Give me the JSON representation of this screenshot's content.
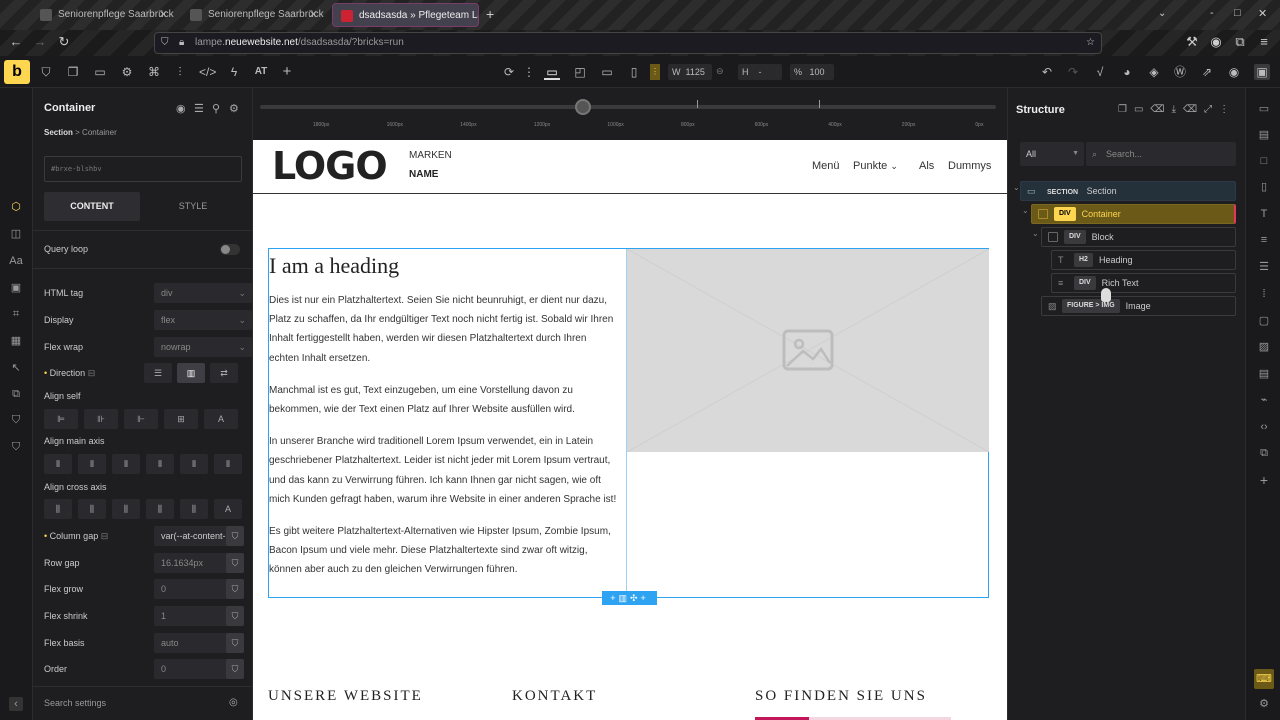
{
  "browser": {
    "tabs": [
      {
        "label": "Seniorenpflege Saarbrücken",
        "active": false
      },
      {
        "label": "Seniorenpflege Saarbrücken",
        "active": false
      },
      {
        "label": "dsadsasda » Pflegeteam La",
        "active": true
      }
    ],
    "new_tab": "+",
    "url_prefix": "lampe.",
    "url_domain": "neuewebsite.net",
    "url_path": "/dsadsasda/?bricks=run"
  },
  "toolbar": {
    "brand": "b",
    "at_label": "AT",
    "width_label": "W",
    "width_value": "1125",
    "height_label": "H",
    "height_value": "-",
    "zoom_label": "%",
    "zoom_value": "100"
  },
  "left_panel": {
    "title": "Container",
    "breadcrumb_root": "Section",
    "breadcrumb_sep": ">",
    "breadcrumb_current": "Container",
    "id_field": "#brxe-blshbv",
    "tab_content": "CONTENT",
    "tab_style": "STYLE",
    "query_loop": "Query loop",
    "html_tag_label": "HTML tag",
    "html_tag_value": "div",
    "display_label": "Display",
    "display_value": "flex",
    "flex_wrap_label": "Flex wrap",
    "flex_wrap_value": "nowrap",
    "direction_label": "Direction",
    "align_self_label": "Align self",
    "align_main_label": "Align main axis",
    "align_cross_label": "Align cross axis",
    "column_gap_label": "Column gap",
    "column_gap_value": "var(--at-content-ga",
    "row_gap_label": "Row gap",
    "row_gap_value": "16.1634px",
    "flex_grow_label": "Flex grow",
    "flex_grow_value": "0",
    "flex_shrink_label": "Flex shrink",
    "flex_shrink_value": "1",
    "flex_basis_label": "Flex basis",
    "flex_basis_value": "auto",
    "order_label": "Order",
    "order_value": "0",
    "search_settings": "Search settings"
  },
  "ruler": {
    "ticks": [
      "1800px",
      "1600px",
      "1400px",
      "1200px",
      "1000px",
      "800px",
      "600px",
      "400px",
      "200px",
      "0px"
    ]
  },
  "site": {
    "logo_text": "LOGO",
    "brand_line1": "MARKEN",
    "brand_line2": "NAME",
    "menu": [
      "Menü",
      "Punkte",
      "Als",
      "Dummys"
    ],
    "heading": "I am a heading",
    "paragraphs": [
      "Dies ist nur ein Platzhaltertext. Seien Sie nicht beunruhigt, er dient nur dazu, Platz zu schaffen, da Ihr endgültiger Text noch nicht fertig ist. Sobald wir Ihren Inhalt fertiggestellt haben, werden wir diesen Platzhaltertext durch Ihren echten Inhalt ersetzen.",
      "Manchmal ist es gut, Text einzugeben, um eine Vorstellung davon zu bekommen, wie der Text einen Platz auf Ihrer Website ausfüllen wird.",
      "In unserer Branche wird traditionell Lorem Ipsum verwendet, ein in Latein geschriebener Platzhaltertext. Leider ist nicht jeder mit Lorem Ipsum vertraut, und das kann zu Verwirrung führen. Ich kann Ihnen gar nicht sagen, wie oft mich Kunden gefragt haben, warum ihre Website in einer anderen Sprache ist!",
      "Es gibt weitere Platzhaltertext-Alternativen wie Hipster Ipsum, Zombie Ipsum, Bacon Ipsum und viele mehr. Diese Platzhaltertexte sind zwar oft witzig, können aber auch zu den gleichen Verwirrungen führen."
    ],
    "footer_cols": [
      "UNSERE WEBSITE",
      "KONTAKT",
      "SO FINDEN SIE UNS"
    ]
  },
  "structure": {
    "title": "Structure",
    "filter_value": "All",
    "search_placeholder": "Search...",
    "nodes": [
      {
        "tag": "SECTION",
        "label": "Section"
      },
      {
        "tag": "DIV",
        "label": "Container"
      },
      {
        "tag": "DIV",
        "label": "Block"
      },
      {
        "tag": "H2",
        "label": "Heading"
      },
      {
        "tag": "DIV",
        "label": "Rich Text"
      },
      {
        "tag": "FIGURE > IMG",
        "label": "Image"
      }
    ]
  },
  "colors": {
    "accent": "#ffd64f",
    "selection": "#2ea3f2",
    "selected_node": "#6b5a17"
  }
}
